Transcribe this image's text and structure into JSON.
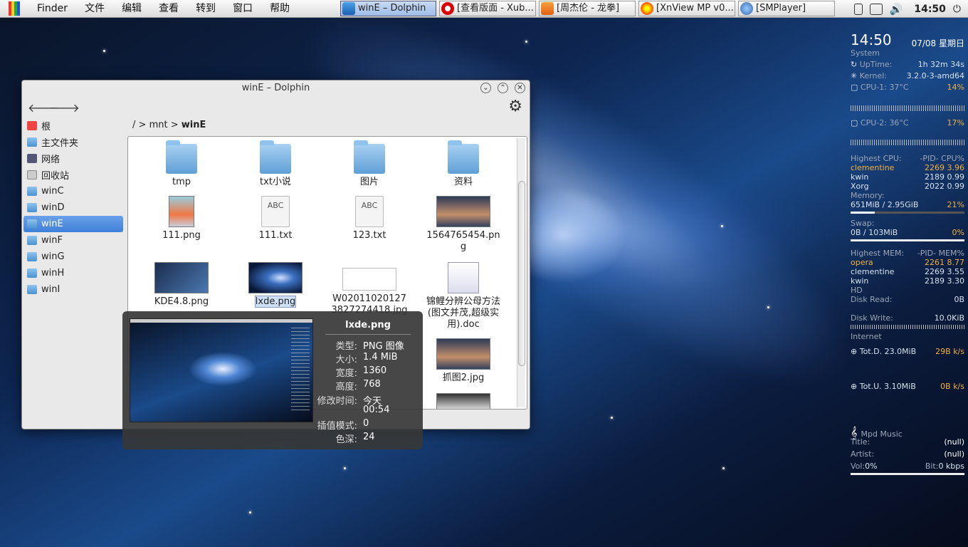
{
  "topbar": {
    "menus": [
      "Finder",
      "文件",
      "编辑",
      "查看",
      "转到",
      "窗口",
      "帮助"
    ],
    "tasks": [
      {
        "label": "winE – Dolphin",
        "icon": "dolphin-icon",
        "active": true
      },
      {
        "label": "[查看版面 - Xub...",
        "icon": "opera-icon"
      },
      {
        "label": "[周杰伦 - 龙拳]",
        "icon": "music-icon"
      },
      {
        "label": "[XnView MP v0...",
        "icon": "xnview-icon"
      },
      {
        "label": "[SMPlayer]",
        "icon": "smplayer-icon"
      }
    ],
    "clock": "14:50"
  },
  "window": {
    "title": "winE – Dolphin",
    "breadcrumb": {
      "root": "/",
      "mnt": "mnt",
      "current": "winE"
    },
    "places": [
      {
        "label": "根",
        "icon": "root-icon"
      },
      {
        "label": "主文件夹",
        "icon": "home-icon"
      },
      {
        "label": "网络",
        "icon": "network-icon"
      },
      {
        "label": "回收站",
        "icon": "trash-icon"
      },
      {
        "label": "winC",
        "icon": "folder-icon"
      },
      {
        "label": "winD",
        "icon": "folder-icon"
      },
      {
        "label": "winE",
        "icon": "folder-icon",
        "selected": true
      },
      {
        "label": "winF",
        "icon": "folder-icon"
      },
      {
        "label": "winG",
        "icon": "folder-icon"
      },
      {
        "label": "winH",
        "icon": "folder-icon"
      },
      {
        "label": "winI",
        "icon": "folder-icon"
      }
    ],
    "files": [
      {
        "name": "tmp",
        "type": "folder"
      },
      {
        "name": "txt小说",
        "type": "folder"
      },
      {
        "name": "图片",
        "type": "folder"
      },
      {
        "name": "资料",
        "type": "folder"
      },
      {
        "name": "111.png",
        "type": "image"
      },
      {
        "name": "111.txt",
        "type": "text",
        "preview": "ABC"
      },
      {
        "name": "123.txt",
        "type": "text",
        "preview": "ABC"
      },
      {
        "name": "1564765454.png",
        "type": "image"
      },
      {
        "name": "KDE4.8.png",
        "type": "image"
      },
      {
        "name": "lxde.png",
        "type": "image",
        "selected": true
      },
      {
        "name": "W020110201273827274418.jpg",
        "type": "image"
      },
      {
        "name": "锦鲤分辨公母方法(图文并茂,超级实用).doc",
        "type": "doc"
      },
      {
        "name": "抓图2.jpg",
        "type": "image"
      }
    ]
  },
  "tooltip": {
    "name": "lxde.png",
    "rows": [
      {
        "k": "类型:",
        "v": "PNG 图像"
      },
      {
        "k": "大小:",
        "v": "1.4 MiB"
      },
      {
        "k": "宽度:",
        "v": "1360"
      },
      {
        "k": "高度:",
        "v": "768"
      },
      {
        "k": "修改时间:",
        "v": "今天"
      },
      {
        "k": "",
        "v": "00:54"
      },
      {
        "k": "插值模式:",
        "v": "0"
      },
      {
        "k": "色深:",
        "v": "24"
      }
    ]
  },
  "conky": {
    "time": "14:50",
    "date": "07/08 星期日",
    "system": "System",
    "uptime_label": "UpTime:",
    "uptime": "1h 32m 34s",
    "kernel_label": "Kernel:",
    "kernel": "3.2.0-3-amd64",
    "cpu1_label": "CPU-1:",
    "cpu1_temp": "37°C",
    "cpu1": "14%",
    "cpu2_label": "CPU-2:",
    "cpu2_temp": "36°C",
    "cpu2": "17%",
    "hcpu_label": "Highest CPU:",
    "hcpu_cols": "-PID-   CPU%",
    "hcpu": [
      {
        "n": "clementine",
        "pid": "2269",
        "v": "3.96"
      },
      {
        "n": "kwin",
        "pid": "2189",
        "v": "0.99"
      },
      {
        "n": "Xorg",
        "pid": "2022",
        "v": "0.99"
      }
    ],
    "mem_label": "Memory:",
    "mem": "651MiB / 2.95GiB",
    "mem_pct": "21%",
    "mem_frac": 0.21,
    "swap_label": "Swap:",
    "swap": "0B   / 103MiB",
    "swap_pct": "0%",
    "hmem_label": "Highest MEM:",
    "hmem_cols": "-PID-  MEM%",
    "hmem": [
      {
        "n": "opera",
        "pid": "2261",
        "v": "8.77"
      },
      {
        "n": "clementine",
        "pid": "2269",
        "v": "3.55"
      },
      {
        "n": "kwin",
        "pid": "2189",
        "v": "3.30"
      }
    ],
    "hd_label": "HD",
    "disk_read_label": "Disk Read:",
    "disk_read": "0B",
    "disk_write_label": "Disk Write:",
    "disk_write": "10.0KiB",
    "internet_label": "Internet",
    "totd_label": "Tot.D.",
    "totd": "23.0MiB",
    "down_rate": "29B",
    "down_unit": "k/s",
    "totu_label": "Tot.U.",
    "totu": "3.10MiB",
    "up_rate": "0B",
    "up_unit": "k/s",
    "mpd_label": "Mpd Music",
    "title_label": "Title:",
    "title": "(null)",
    "artist_label": "Artist:",
    "artist": "(null)",
    "vol_label": "Vol:",
    "vol": "0%",
    "bit_label": "Bit:",
    "bit": "0 kbps"
  }
}
